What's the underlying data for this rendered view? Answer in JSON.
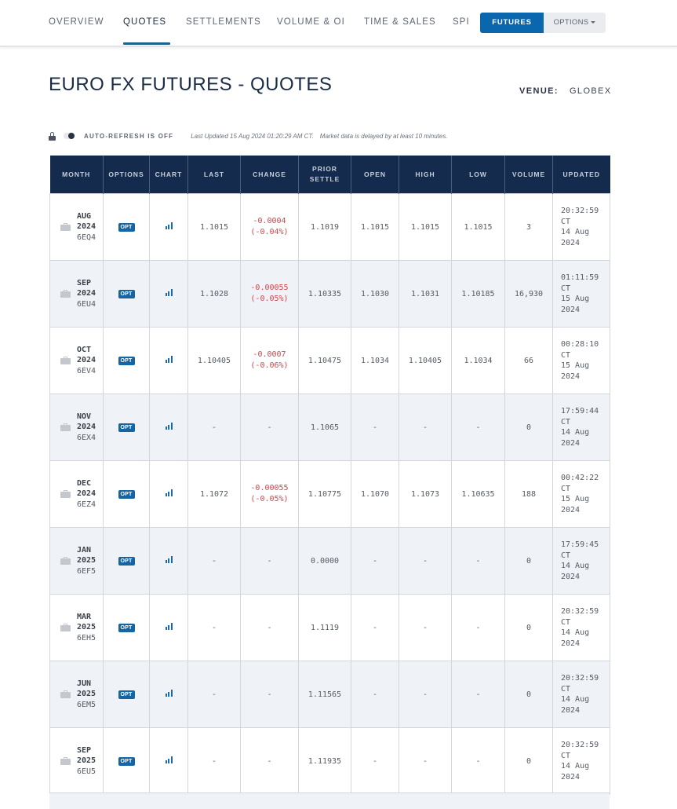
{
  "nav": {
    "tabs": [
      {
        "label": "OVERVIEW",
        "active": false
      },
      {
        "label": "QUOTES",
        "active": true
      },
      {
        "label": "SETTLEMENTS",
        "active": false
      },
      {
        "label": "VOLUME & OI",
        "active": false
      },
      {
        "label": "TIME & SALES",
        "active": false
      },
      {
        "label": "SPI",
        "active": false
      }
    ],
    "segment": {
      "futures_label": "FUTURES",
      "options_label": "OPTIONS",
      "selected": "FUTURES"
    }
  },
  "header": {
    "title": "EURO FX FUTURES - QUOTES",
    "venue_label": "VENUE:",
    "venue_value": "GLOBEX"
  },
  "status": {
    "auto_refresh": "AUTO-REFRESH IS OFF",
    "last_updated": "Last Updated 15 Aug 2024 01:20:29 AM CT.",
    "delay_note": "Market data is delayed by at least 10 minutes."
  },
  "colors": {
    "header_bg": "#152b4d",
    "accent": "#0b67ad",
    "negative": "#d0454b",
    "alt_row": "#eff2f6"
  },
  "table": {
    "columns": [
      "MONTH",
      "OPTIONS",
      "CHART",
      "LAST",
      "CHANGE",
      "PRIOR SETTLE",
      "OPEN",
      "HIGH",
      "LOW",
      "VOLUME",
      "UPDATED"
    ],
    "option_badge": "OPT",
    "time_zone": "CT",
    "rows": [
      {
        "month": "AUG",
        "year": "2024",
        "code": "6EQ4",
        "last": "1.1015",
        "change": "-0.0004",
        "change_pct": "(-0.04%)",
        "prior_settle": "1.1019",
        "open": "1.1015",
        "high": "1.1015",
        "low": "1.1015",
        "volume": "3",
        "updated_time": "20:32:59",
        "updated_date": "14 Aug",
        "updated_year": "2024"
      },
      {
        "month": "SEP",
        "year": "2024",
        "code": "6EU4",
        "last": "1.1028",
        "change": "-0.00055",
        "change_pct": "(-0.05%)",
        "prior_settle": "1.10335",
        "open": "1.1030",
        "high": "1.1031",
        "low": "1.10185",
        "volume": "16,930",
        "updated_time": "01:11:59",
        "updated_date": "15 Aug",
        "updated_year": "2024"
      },
      {
        "month": "OCT",
        "year": "2024",
        "code": "6EV4",
        "last": "1.10405",
        "change": "-0.0007",
        "change_pct": "(-0.06%)",
        "prior_settle": "1.10475",
        "open": "1.1034",
        "high": "1.10405",
        "low": "1.1034",
        "volume": "66",
        "updated_time": "00:28:10",
        "updated_date": "15 Aug",
        "updated_year": "2024"
      },
      {
        "month": "NOV",
        "year": "2024",
        "code": "6EX4",
        "last": "-",
        "change": "-",
        "change_pct": "",
        "prior_settle": "1.1065",
        "open": "-",
        "high": "-",
        "low": "-",
        "volume": "0",
        "updated_time": "17:59:44",
        "updated_date": "14 Aug",
        "updated_year": "2024"
      },
      {
        "month": "DEC",
        "year": "2024",
        "code": "6EZ4",
        "last": "1.1072",
        "change": "-0.00055",
        "change_pct": "(-0.05%)",
        "prior_settle": "1.10775",
        "open": "1.1070",
        "high": "1.1073",
        "low": "1.10635",
        "volume": "188",
        "updated_time": "00:42:22",
        "updated_date": "15 Aug",
        "updated_year": "2024"
      },
      {
        "month": "JAN",
        "year": "2025",
        "code": "6EF5",
        "last": "-",
        "change": "-",
        "change_pct": "",
        "prior_settle": "0.0000",
        "open": "-",
        "high": "-",
        "low": "-",
        "volume": "0",
        "updated_time": "17:59:45",
        "updated_date": "14 Aug",
        "updated_year": "2024"
      },
      {
        "month": "MAR",
        "year": "2025",
        "code": "6EH5",
        "last": "-",
        "change": "-",
        "change_pct": "",
        "prior_settle": "1.1119",
        "open": "-",
        "high": "-",
        "low": "-",
        "volume": "0",
        "updated_time": "20:32:59",
        "updated_date": "14 Aug",
        "updated_year": "2024"
      },
      {
        "month": "JUN",
        "year": "2025",
        "code": "6EM5",
        "last": "-",
        "change": "-",
        "change_pct": "",
        "prior_settle": "1.11565",
        "open": "-",
        "high": "-",
        "low": "-",
        "volume": "0",
        "updated_time": "20:32:59",
        "updated_date": "14 Aug",
        "updated_year": "2024"
      },
      {
        "month": "SEP",
        "year": "2025",
        "code": "6EU5",
        "last": "-",
        "change": "-",
        "change_pct": "",
        "prior_settle": "1.11935",
        "open": "-",
        "high": "-",
        "low": "-",
        "volume": "0",
        "updated_time": "20:32:59",
        "updated_date": "14 Aug",
        "updated_year": "2024"
      }
    ]
  }
}
